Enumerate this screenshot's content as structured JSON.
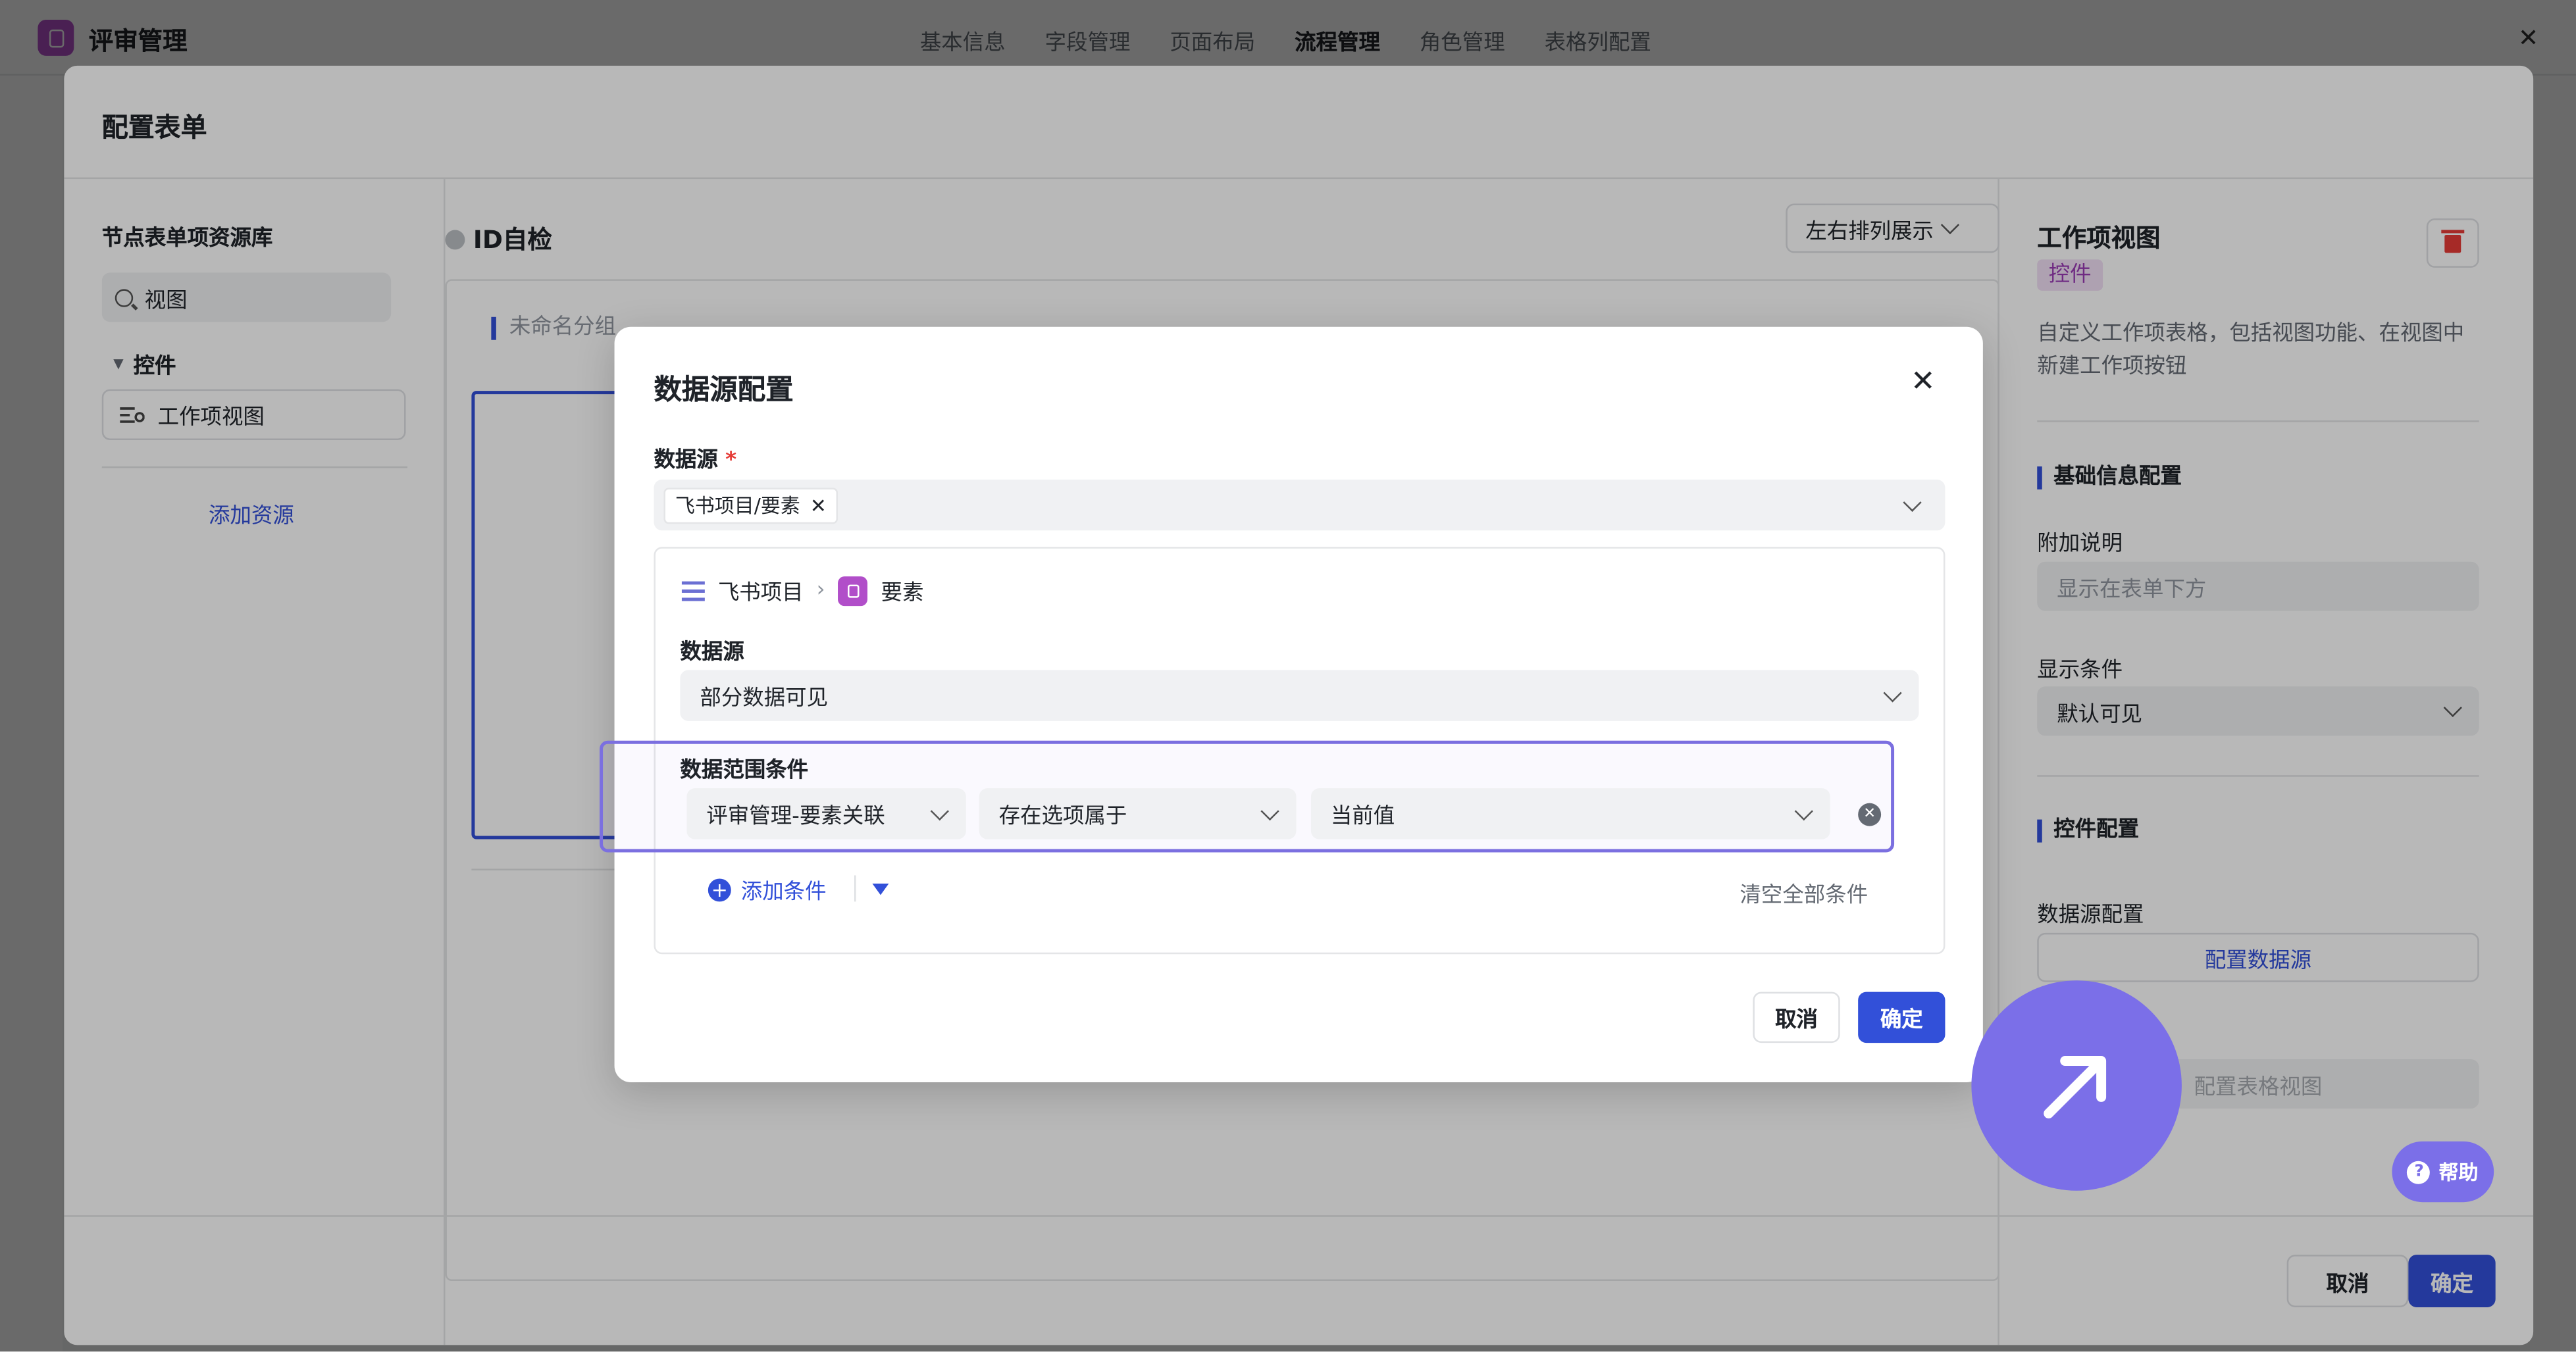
{
  "app": {
    "title": "评审管理",
    "tabs": [
      "基本信息",
      "字段管理",
      "页面布局",
      "流程管理",
      "角色管理",
      "表格列配置"
    ],
    "active_tab": "流程管理"
  },
  "panel": {
    "title": "配置表单",
    "library": {
      "title": "节点表单项资源库",
      "search_value": "视图",
      "group": "控件",
      "item": "工作项视图",
      "add_resource": "添加资源"
    },
    "canvas": {
      "id_check": "ID自检",
      "layout_select": "左右排列展示",
      "unnamed_group": "未命名分组"
    },
    "right": {
      "title": "工作项视图",
      "tag": "控件",
      "description": "自定义工作项表格，包括视图功能、在视图中新建工作项按钮",
      "section_basic": "基础信息配置",
      "extra_label": "附加说明",
      "extra_placeholder": "显示在表单下方",
      "cond_label": "显示条件",
      "cond_value": "默认可见",
      "section_control": "控件配置",
      "ds_config_label": "数据源配置",
      "ds_config_button": "配置数据源",
      "table_view_button": "配置表格视图"
    },
    "cancel": "取消",
    "confirm": "确定"
  },
  "dialog": {
    "title": "数据源配置",
    "ds_label": "数据源",
    "required_mark": "*",
    "chip": "飞书项目/要素",
    "breadcrumb": [
      "飞书项目",
      "要素"
    ],
    "inner_ds_label": "数据源",
    "inner_ds_value": "部分数据可见",
    "range_label": "数据范围条件",
    "cond_field": "评审管理-要素关联",
    "cond_op": "存在选项属于",
    "cond_value": "当前值",
    "add_condition": "添加条件",
    "clear_all": "清空全部条件",
    "cancel": "取消",
    "confirm": "确定"
  },
  "help": {
    "label": "帮助"
  },
  "colors": {
    "accent": "#3250d9",
    "brand": "#b14ec9",
    "floating": "#7b6fe8",
    "danger": "#e63b36"
  }
}
